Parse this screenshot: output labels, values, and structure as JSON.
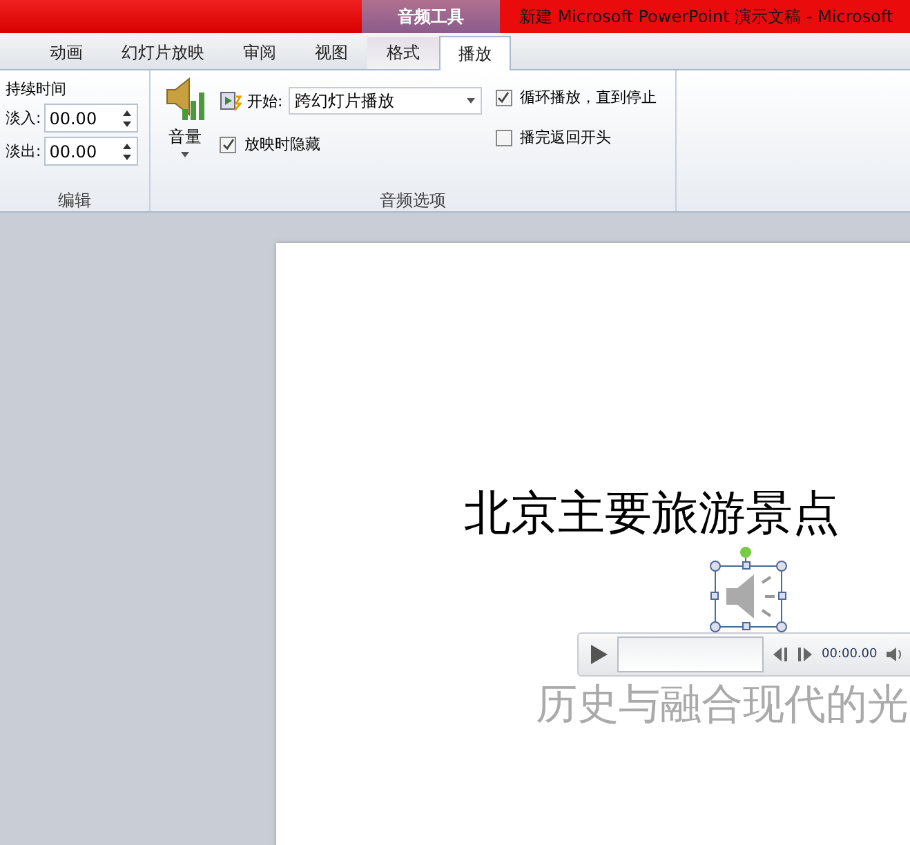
{
  "title_bar": {
    "context_tool": "音频工具",
    "title": "新建 Microsoft PowerPoint 演示文稿 - Microsoft"
  },
  "tabs": [
    {
      "label": "动画",
      "selected": false,
      "context": false
    },
    {
      "label": "幻灯片放映",
      "selected": false,
      "context": false
    },
    {
      "label": "审阅",
      "selected": false,
      "context": false
    },
    {
      "label": "视图",
      "selected": false,
      "context": false
    },
    {
      "label": "格式",
      "selected": false,
      "context": true
    },
    {
      "label": "播放",
      "selected": true,
      "context": true
    }
  ],
  "edit_group": {
    "heading": "持续时间",
    "fade_in": {
      "label": "淡入:",
      "value": "00.00"
    },
    "fade_out": {
      "label": "淡出:",
      "value": "00.00"
    },
    "name": "编辑"
  },
  "audio_group": {
    "volume": "音量",
    "start_label": "开始:",
    "start_value": "跨幻灯片播放",
    "options": [
      {
        "label": "放映时隐藏",
        "checked": true
      },
      {
        "label": "循环播放，直到停止",
        "checked": true
      },
      {
        "label": "播完返回开头",
        "checked": false
      }
    ],
    "name": "音频选项"
  },
  "slide": {
    "title": "北京主要旅游景点",
    "subtitle": "历史与融合现代的光",
    "player": {
      "level": 0,
      "time": "00:00.00"
    }
  }
}
